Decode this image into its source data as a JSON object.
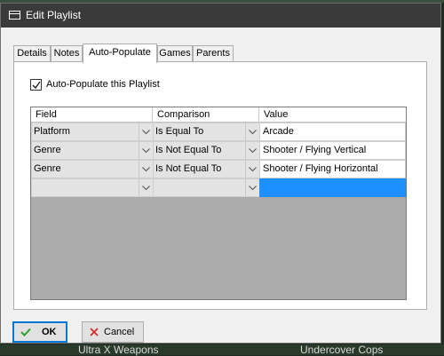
{
  "window": {
    "title": "Edit Playlist"
  },
  "background": {
    "left_text": "Ultra X Weapons",
    "right_text": "Undercover Cops"
  },
  "tabs": [
    {
      "label": "Details",
      "active": false
    },
    {
      "label": "Notes",
      "active": false
    },
    {
      "label": "Auto-Populate",
      "active": true
    },
    {
      "label": "Games",
      "active": false
    },
    {
      "label": "Parents",
      "active": false
    }
  ],
  "auto_populate": {
    "checkbox_label": "Auto-Populate this Playlist",
    "checked": true
  },
  "grid": {
    "columns": [
      "Field",
      "Comparison",
      "Value"
    ],
    "rows": [
      {
        "field": "Platform",
        "comparison": "Is Equal To",
        "value": "Arcade"
      },
      {
        "field": "Genre",
        "comparison": "Is Not Equal To",
        "value": "Shooter / Flying Vertical"
      },
      {
        "field": "Genre",
        "comparison": "Is Not Equal To",
        "value": "Shooter / Flying Horizontal"
      },
      {
        "field": "",
        "comparison": "",
        "value": "",
        "selected": true
      }
    ]
  },
  "buttons": {
    "ok": "OK",
    "cancel": "Cancel"
  },
  "colors": {
    "accent": "#1e8fff",
    "ok_check": "#2e9e2e",
    "cancel_x": "#d32f2f",
    "grid_empty": "#ababab"
  }
}
